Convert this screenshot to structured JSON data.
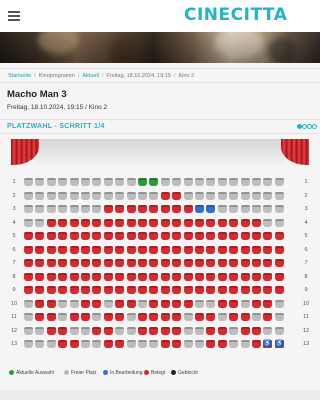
{
  "header": {
    "logo": "CINECITTA",
    "menu_icon": "hamburger-menu-icon"
  },
  "breadcrumb": [
    {
      "label": "Startseite",
      "link": true
    },
    {
      "label": "Kinoprogramm",
      "link": false
    },
    {
      "label": "Aktuell",
      "link": true
    },
    {
      "label": "Freitag, 18.10.2024, 19:15",
      "link": false
    },
    {
      "label": "Kino 2",
      "link": false
    }
  ],
  "movie": {
    "title": "Macho Man 3",
    "showtime": "Freitag, 18.10.2024, 19:15 / Kino 2"
  },
  "step": {
    "title": "PLATZWAHL - SCHRITT 1/4",
    "current": 1,
    "total": 4
  },
  "colors": {
    "accent": "#23b3c7",
    "free": "#bdbdbd",
    "taken": "#d82a2e",
    "selected": "#2b9a3b",
    "in_progress": "#2e6fd1",
    "blocked": "#222222",
    "wheelchair": "#5a5a5a"
  },
  "seat_map": {
    "rows": [
      {
        "label": "1",
        "states": [
          "F",
          "F",
          "F",
          "F",
          "F",
          "F",
          "F",
          "F",
          "F",
          "F",
          "S",
          "S",
          "F",
          "F",
          "F",
          "F",
          "F",
          "F",
          "F",
          "F",
          "F",
          "F",
          "F"
        ]
      },
      {
        "label": "2",
        "states": [
          "F",
          "F",
          "F",
          "F",
          "F",
          "F",
          "F",
          "F",
          "F",
          "F",
          "F",
          "F",
          "T",
          "T",
          "F",
          "F",
          "F",
          "F",
          "F",
          "F",
          "F",
          "F",
          "F"
        ]
      },
      {
        "label": "3",
        "states": [
          "F",
          "F",
          "F",
          "F",
          "F",
          "F",
          "F",
          "T",
          "T",
          "T",
          "T",
          "T",
          "T",
          "T",
          "T",
          "B",
          "B",
          "F",
          "F",
          "F",
          "F",
          "F",
          "F"
        ]
      },
      {
        "label": "4",
        "states": [
          "F",
          "F",
          "T",
          "T",
          "T",
          "T",
          "T",
          "T",
          "T",
          "T",
          "T",
          "T",
          "T",
          "T",
          "T",
          "T",
          "T",
          "T",
          "T",
          "T",
          "T",
          "F",
          "F"
        ]
      },
      {
        "label": "5",
        "states": [
          "T",
          "T",
          "T",
          "T",
          "T",
          "T",
          "T",
          "T",
          "T",
          "T",
          "T",
          "T",
          "T",
          "T",
          "T",
          "T",
          "T",
          "T",
          "T",
          "T",
          "T",
          "T",
          "T"
        ]
      },
      {
        "label": "6",
        "states": [
          "T",
          "T",
          "T",
          "T",
          "T",
          "T",
          "T",
          "T",
          "T",
          "T",
          "T",
          "T",
          "T",
          "T",
          "T",
          "T",
          "T",
          "T",
          "T",
          "T",
          "T",
          "T",
          "T"
        ]
      },
      {
        "label": "7",
        "states": [
          "T",
          "T",
          "T",
          "T",
          "T",
          "T",
          "T",
          "T",
          "T",
          "T",
          "T",
          "T",
          "T",
          "T",
          "T",
          "T",
          "T",
          "T",
          "T",
          "T",
          "T",
          "T",
          "T"
        ]
      },
      {
        "label": "8",
        "states": [
          "T",
          "T",
          "T",
          "T",
          "T",
          "T",
          "T",
          "T",
          "T",
          "T",
          "T",
          "T",
          "T",
          "T",
          "T",
          "T",
          "T",
          "T",
          "T",
          "T",
          "T",
          "T",
          "T"
        ]
      },
      {
        "label": "9",
        "states": [
          "T",
          "T",
          "T",
          "T",
          "T",
          "T",
          "T",
          "T",
          "T",
          "T",
          "T",
          "T",
          "T",
          "T",
          "T",
          "T",
          "T",
          "T",
          "T",
          "T",
          "T",
          "T",
          "T"
        ]
      },
      {
        "label": "10",
        "states": [
          "F",
          "T",
          "T",
          "F",
          "F",
          "T",
          "T",
          "F",
          "T",
          "T",
          "F",
          "T",
          "T",
          "T",
          "T",
          "F",
          "F",
          "T",
          "T",
          "F",
          "T",
          "T",
          "F"
        ]
      },
      {
        "label": "11",
        "states": [
          "F",
          "T",
          "T",
          "F",
          "T",
          "T",
          "F",
          "T",
          "T",
          "F",
          "T",
          "T",
          "T",
          "T",
          "F",
          "T",
          "T",
          "F",
          "T",
          "T",
          "F",
          "T",
          "F"
        ]
      },
      {
        "label": "12",
        "states": [
          "F",
          "F",
          "T",
          "T",
          "F",
          "F",
          "T",
          "T",
          "F",
          "F",
          "T",
          "T",
          "T",
          "T",
          "F",
          "F",
          "T",
          "T",
          "F",
          "T",
          "T",
          "F",
          "F"
        ]
      },
      {
        "label": "13",
        "states": [
          "F",
          "F",
          "F",
          "T",
          "T",
          "F",
          "F",
          "T",
          "T",
          "F",
          "F",
          "F",
          "T",
          "T",
          "F",
          "F",
          "T",
          "T",
          "F",
          "F",
          "T",
          "W",
          "W"
        ]
      }
    ]
  },
  "legend": [
    {
      "label": "Aktuelle Auswahl",
      "color": "#2b9a3b"
    },
    {
      "label": "Freier Platz",
      "color": "#bdbdbd"
    },
    {
      "label": "In Bearbeitung",
      "color": "#2e6fd1"
    },
    {
      "label": "Belegt",
      "color": "#d82a2e"
    },
    {
      "label": "Geblockt",
      "color": "#222222"
    }
  ]
}
